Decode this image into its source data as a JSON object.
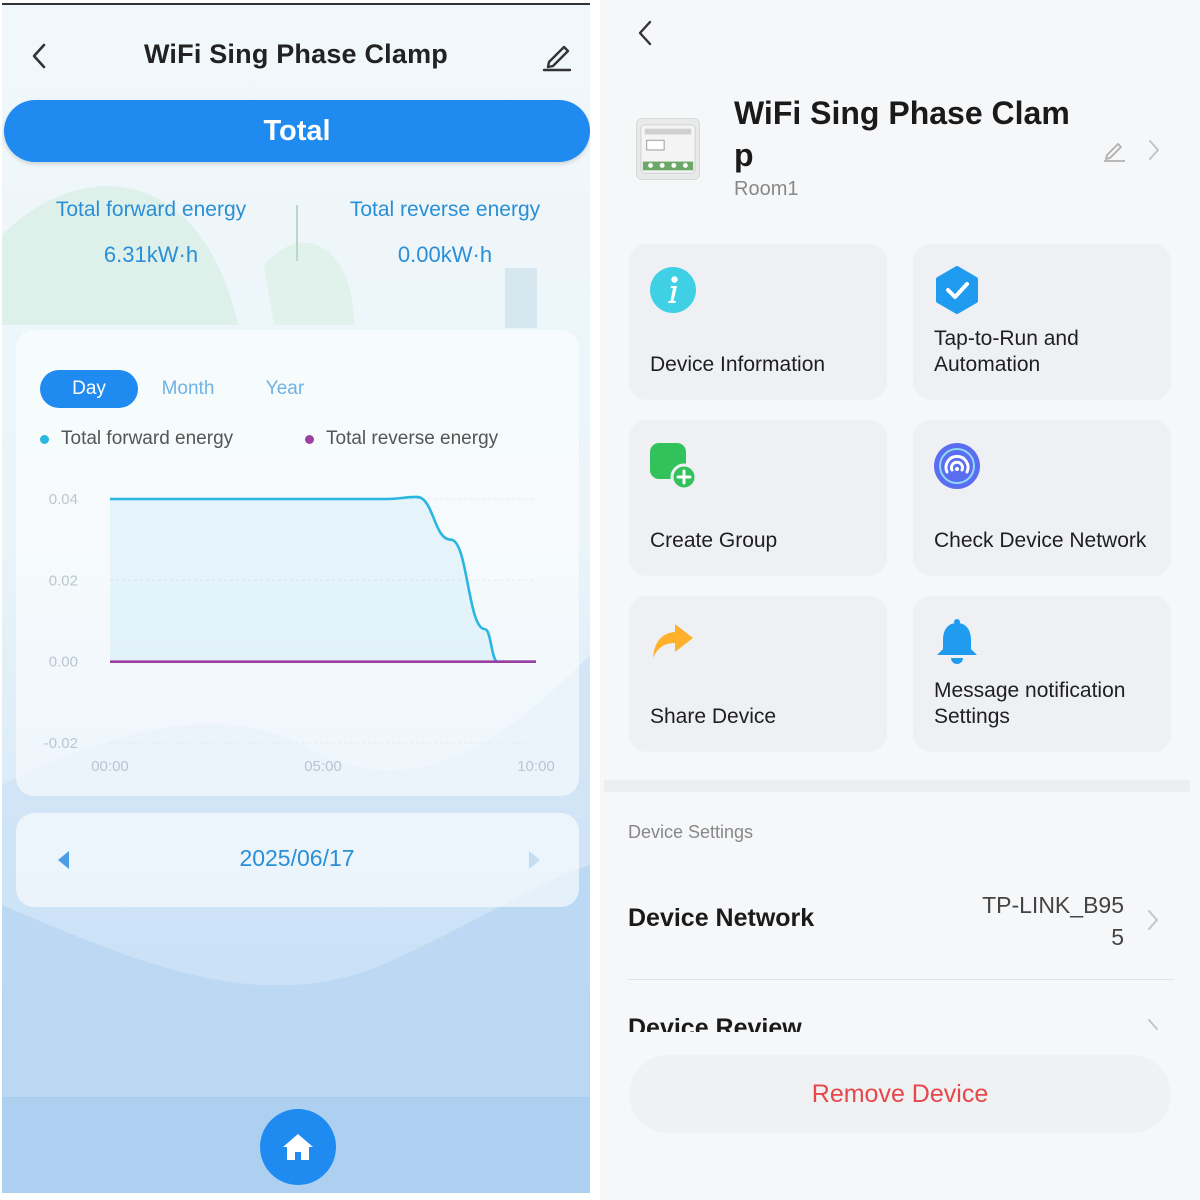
{
  "left": {
    "title": "WiFi Sing Phase Clamp",
    "tab": "Total",
    "forward": {
      "label": "Total forward energy",
      "value": "6.31kW·h"
    },
    "reverse": {
      "label": "Total reverse energy",
      "value": "0.00kW·h"
    },
    "periods": [
      "Day",
      "Month",
      "Year"
    ],
    "legend": {
      "forward": "Total forward energy",
      "reverse": "Total reverse energy"
    },
    "date": "2025/06/17",
    "colors": {
      "accent": "#1f8bf0",
      "forward": "#29b6e0",
      "reverse": "#9b3fa0"
    }
  },
  "chart_data": {
    "type": "line",
    "x_ticks": [
      "00:00",
      "05:00",
      "10:00"
    ],
    "y_ticks": [
      "0.04",
      "0.02",
      "0.00",
      "-0.02"
    ],
    "ylim": [
      -0.02,
      0.04
    ],
    "series": [
      {
        "name": "Total forward energy",
        "x": [
          0,
          6.5,
          7.2,
          8.0,
          8.8,
          9.1,
          10.0
        ],
        "values": [
          0.04,
          0.04,
          0.0405,
          0.03,
          0.008,
          0.0,
          0.0
        ]
      },
      {
        "name": "Total reverse energy",
        "x": [
          0,
          10.0
        ],
        "values": [
          0.0,
          0.0
        ]
      }
    ]
  },
  "right": {
    "device_name": "WiFi Sing Phase Clamp",
    "room": "Room1",
    "tiles": [
      {
        "label": "Device Information",
        "icon": "info-icon"
      },
      {
        "label": "Tap-to-Run and Automation",
        "icon": "check-badge-icon"
      },
      {
        "label": "Create Group",
        "icon": "create-group-icon"
      },
      {
        "label": "Check Device Network",
        "icon": "network-icon"
      },
      {
        "label": "Share Device",
        "icon": "share-icon"
      },
      {
        "label": "Message notification Settings",
        "icon": "bell-icon"
      }
    ],
    "section": "Device Settings",
    "network": {
      "label": "Device Network",
      "value": "TP-LINK_B955"
    },
    "review": {
      "label": "Device Review"
    },
    "remove": "Remove Device"
  }
}
